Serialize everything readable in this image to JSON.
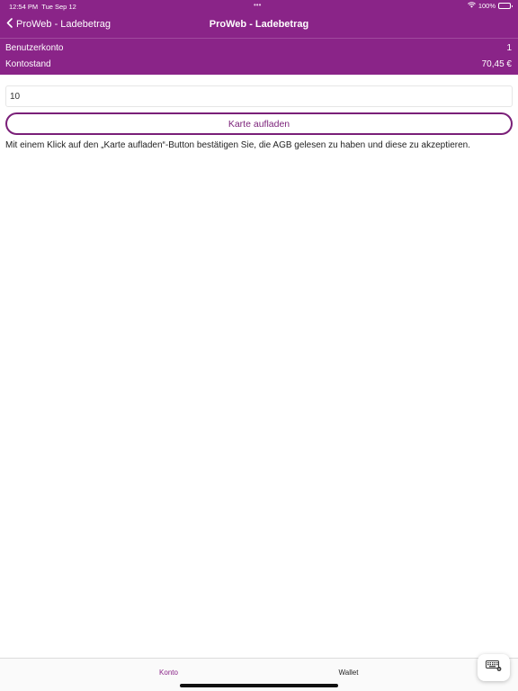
{
  "status": {
    "time": "12:54 PM",
    "date": "Tue Sep 12",
    "dots": "•••",
    "battery": "100%",
    "battery_level": 1.0
  },
  "navbar": {
    "back_label": "ProWeb - Ladebetrag",
    "title": "ProWeb - Ladebetrag"
  },
  "account": {
    "user_label": "Benutzerkonto",
    "user_value": "1",
    "balance_label": "Kontostand",
    "balance_value": "70,45 €"
  },
  "form": {
    "amount_value": "10",
    "charge_label": "Karte aufladen",
    "note": "Mit einem Klick auf den „Karte aufladen“-Button bestätigen Sie, die AGB gelesen zu haben und diese zu akzeptieren."
  },
  "tabs": [
    {
      "label": "Konto",
      "active": true
    },
    {
      "label": "Wallet",
      "active": false
    }
  ],
  "colors": {
    "brand": "#8a2488",
    "button_border": "#7a1f78",
    "caret": "#1a8a3a"
  },
  "icons": [
    "chevron-left-icon",
    "wifi-icon",
    "battery-icon",
    "keyboard-icon"
  ]
}
